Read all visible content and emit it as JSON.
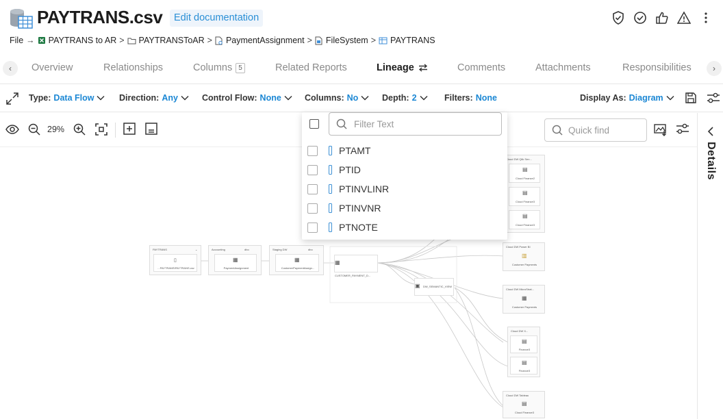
{
  "header": {
    "title": "PAYTRANS.csv",
    "edit_doc_label": "Edit documentation",
    "icons": [
      "shield-check-icon",
      "check-circle-icon",
      "thumbs-up-icon",
      "warning-icon",
      "more-vertical-icon"
    ]
  },
  "breadcrumb": {
    "root": "File",
    "items": [
      "PAYTRANS to AR",
      "PAYTRANSToAR",
      "PaymentAssignment",
      "FileSystem",
      "PAYTRANS"
    ],
    "separator": ">"
  },
  "tabs": {
    "items": [
      {
        "label": "Overview"
      },
      {
        "label": "Relationships"
      },
      {
        "label": "Columns",
        "badge": "5"
      },
      {
        "label": "Related Reports"
      },
      {
        "label": "Lineage",
        "active": true
      },
      {
        "label": "Comments"
      },
      {
        "label": "Attachments"
      },
      {
        "label": "Responsibilities"
      }
    ]
  },
  "filters": {
    "type": {
      "label": "Type:",
      "value": "Data Flow"
    },
    "direction": {
      "label": "Direction:",
      "value": "Any"
    },
    "control_flow": {
      "label": "Control Flow:",
      "value": "None"
    },
    "columns": {
      "label": "Columns:",
      "value": "No"
    },
    "depth": {
      "label": "Depth:",
      "value": "2"
    },
    "filters": {
      "label": "Filters:",
      "value": "None"
    },
    "display_as": {
      "label": "Display As:",
      "value": "Diagram"
    }
  },
  "canvas": {
    "zoom": "29%",
    "quick_find_placeholder": "Quick find",
    "details_label": "Details"
  },
  "columns_dropdown": {
    "filter_placeholder": "Filter Text",
    "items": [
      "PTAMT",
      "PTID",
      "PTINVLINR",
      "PTINVNR",
      "PTNOTE"
    ]
  },
  "diagram": {
    "nodes": {
      "paytrans": {
        "header": "PAYTRANS",
        "child": "...PAYTRANS\\PAYTRANS.csv"
      },
      "accounting": {
        "header": "Accounting",
        "tag": "dbo",
        "child": "PaymentAssignment"
      },
      "staging": {
        "header": "Staging DW",
        "tag": "dbo",
        "child": "CustomerPaymentAssign..."
      },
      "customer_payment": {
        "child": "CUSTOMER_PAYMENT_D..."
      },
      "semantic": {
        "child": "DW_SEMANTIC_VIEW"
      },
      "qlik": {
        "header": "Cloud DW Qlik Sen...",
        "children": [
          "Cloud Finance2",
          "Cloud Finance3",
          "Cloud Finance3"
        ]
      },
      "powerbi": {
        "header": "Cloud DW Power BI",
        "child": "Customer Payments"
      },
      "microstrategy": {
        "header": "Cloud DW MicroStrat...",
        "child": "Customer Payments"
      },
      "looker": {
        "header": "Cloud DW X...",
        "children": [
          "Finance3",
          "Finance3"
        ]
      },
      "tableau": {
        "header": "Cloud DW Tableau",
        "child": "Cloud Finance3"
      }
    }
  },
  "colors": {
    "accent": "#1b87d4",
    "edit_doc_bg": "#eef4fb",
    "column_icon": "#3b8fd4"
  }
}
